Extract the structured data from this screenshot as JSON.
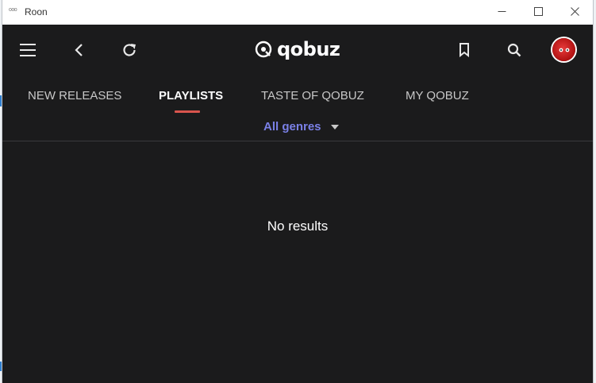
{
  "window": {
    "app_icon": "roon-icon",
    "title": "Roon",
    "controls": [
      "minimize-icon",
      "maximize-icon",
      "close-icon"
    ]
  },
  "header": {
    "menu_icon": "hamburger-menu-icon",
    "back_icon": "back-arrow-icon",
    "refresh_icon": "refresh-icon",
    "logo_text": "qobuz",
    "bookmark_icon": "bookmark-icon",
    "search_icon": "search-icon",
    "avatar_icon": "user-avatar-icon"
  },
  "tabs": [
    {
      "label": "NEW RELEASES",
      "active": false
    },
    {
      "label": "PLAYLISTS",
      "active": true
    },
    {
      "label": "TASTE OF QOBUZ",
      "active": false
    },
    {
      "label": "MY QOBUZ",
      "active": false
    }
  ],
  "filter": {
    "genre_label": "All genres",
    "genre_icon": "caret-down-icon"
  },
  "content": {
    "empty_message": "No results"
  },
  "colors": {
    "background": "#1b1b1c",
    "accent_underline": "#d9554d",
    "genre_link": "#7a80e6",
    "titlebar": "#ffffff"
  }
}
